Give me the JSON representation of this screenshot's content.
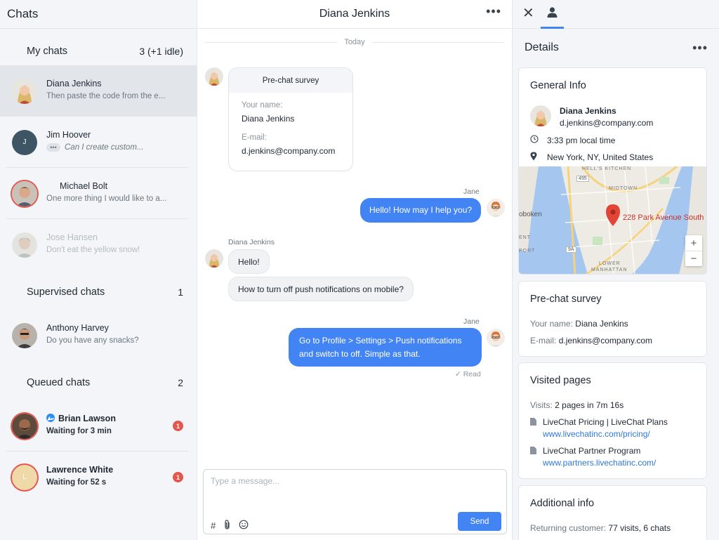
{
  "sidebar": {
    "title": "Chats",
    "my_chats": {
      "label": "My chats",
      "count": "3 (+1 idle)",
      "items": [
        {
          "name": "Diana Jenkins",
          "preview": "Then paste the code from the e..."
        },
        {
          "name": "Jim Hoover",
          "initial": "J",
          "typing": "•••",
          "preview": "Can I create custom..."
        },
        {
          "name": "Michael Bolt",
          "preview": "One more thing I would like to a..."
        },
        {
          "name": "Jose Hansen",
          "preview": "Don't eat the yellow snow!"
        }
      ]
    },
    "supervised": {
      "label": "Supervised chats",
      "count": "1",
      "items": [
        {
          "name": "Anthony Harvey",
          "preview": "Do you have any snacks?"
        }
      ]
    },
    "queued": {
      "label": "Queued chats",
      "count": "2",
      "items": [
        {
          "name": "Brian Lawson",
          "preview": "Waiting for 3 min",
          "badge": "1"
        },
        {
          "name": "Lawrence White",
          "initial": "L",
          "preview": "Waiting for 52 s",
          "badge": "1"
        }
      ]
    }
  },
  "chat": {
    "title": "Diana Jenkins",
    "more": "•••",
    "date_divider": "Today",
    "survey": {
      "title": "Pre-chat survey",
      "name_label": "Your name:",
      "name_value": "Diana Jenkins",
      "email_label": "E-mail:",
      "email_value": "d.jenkins@company.com"
    },
    "messages": [
      {
        "sender": "Jane",
        "text": "Hello! How may I help you?"
      },
      {
        "sender": "Diana Jenkins",
        "text": "Hello!"
      },
      {
        "text": "How to turn off push notifications on mobile?"
      },
      {
        "sender": "Jane",
        "text": "Go to Profile > Settings > Push notifications and switch to off. Simple as that."
      }
    ],
    "read_status": "✓ Read",
    "composer": {
      "placeholder": "Type a message...",
      "hash": "#",
      "send_label": "Send"
    }
  },
  "details": {
    "title": "Details",
    "more": "•••",
    "close": "✕",
    "general": {
      "title": "General Info",
      "name": "Diana Jenkins",
      "email": "d.jenkins@company.com",
      "local_time": "3:33 pm local time",
      "location": "New York, NY, United States",
      "map": {
        "pin_label": "228 Park Avenue South",
        "areas": [
          "HELL'S KITCHEN",
          "MIDTOWN",
          "oboken",
          "PORT",
          "LOWER",
          "MANHATTAN",
          "ENT"
        ],
        "routes": [
          "495",
          "9A"
        ],
        "zoom_in": "+",
        "zoom_out": "−"
      }
    },
    "prechat": {
      "title": "Pre-chat survey",
      "name_label": "Your name:",
      "name_value": "Diana Jenkins",
      "email_label": "E-mail:",
      "email_value": "d.jenkins@company.com"
    },
    "visited": {
      "title": "Visited pages",
      "visits_label": "Visits:",
      "visits_value": "2 pages in 7m 16s",
      "pages": [
        {
          "title": "LiveChat Pricing | LiveChat Plans",
          "url": "www.livechatinc.com/pricing/"
        },
        {
          "title": "LiveChat Partner Program",
          "url": "www.partners.livechatinc.com/"
        }
      ]
    },
    "additional": {
      "title": "Additional info",
      "returning_label": "Returning customer:",
      "returning_value": "77 visits, 6 chats"
    }
  },
  "colors": {
    "accent": "#4384f5",
    "badge": "#e4574f",
    "link": "#2e78d8"
  }
}
